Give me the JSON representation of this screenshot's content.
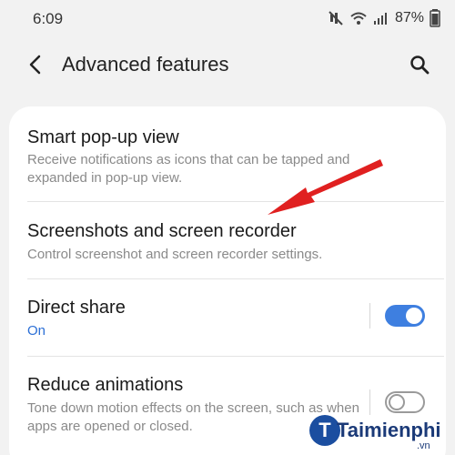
{
  "status_bar": {
    "time": "6:09",
    "battery": "87%",
    "icons": [
      "mute-icon",
      "wifi-icon",
      "signal-icon",
      "battery-icon"
    ]
  },
  "header": {
    "title": "Advanced features",
    "back_icon": "back-arrow-icon",
    "search_icon": "search-icon"
  },
  "settings": [
    {
      "title": "Smart pop-up view",
      "description": "Receive notifications as icons that can be tapped and expanded in pop-up view."
    },
    {
      "title": "Screenshots and screen recorder",
      "description": "Control screenshot and screen recorder settings."
    },
    {
      "title": "Direct share",
      "status": "On",
      "toggle": "on"
    },
    {
      "title": "Reduce animations",
      "description": "Tone down motion effects on the screen, such as when apps are opened or closed.",
      "toggle": "off"
    }
  ],
  "colors": {
    "accent": "#3e7fe0",
    "status_on_text": "#2b6fd6",
    "annotation_arrow": "#e02020",
    "background": "#f2f2f2",
    "card": "#ffffff"
  },
  "watermark": {
    "brand": "Taimienphi",
    "domain": ".vn"
  }
}
